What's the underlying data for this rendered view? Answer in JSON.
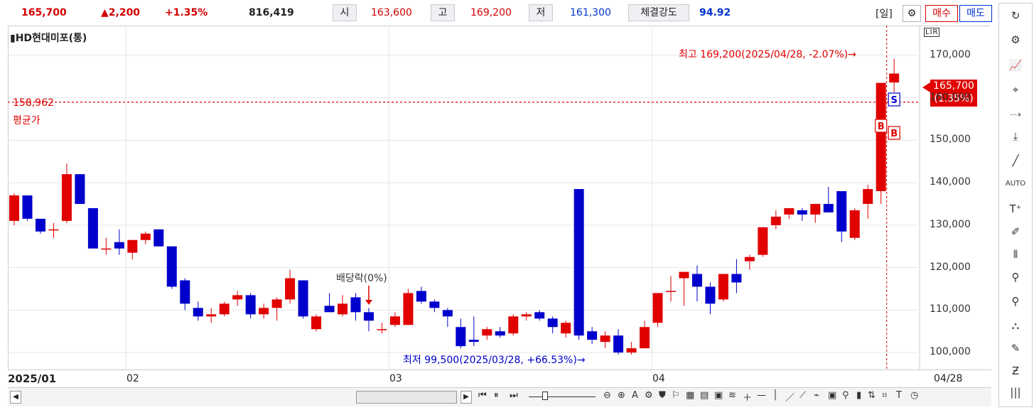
{
  "quote": {
    "price": "165,700",
    "change": "▲2,200",
    "change_pct": "+1.35%",
    "volume": "816,419",
    "open_label": "시",
    "open": "163,600",
    "high_label": "고",
    "high": "169,200",
    "low_label": "저",
    "low": "161,300",
    "strength_label": "체결강도",
    "strength": "94.92"
  },
  "toolbar": {
    "period": "[일]",
    "buy": "매수",
    "sell": "매도",
    "mode_badges": "LIR"
  },
  "chart": {
    "stock_name": "HD현대미포(통)",
    "avg_price_value": "158,962",
    "avg_price_label": "평균가",
    "high_note": "최고 169,200(2025/04/28, -2.07%)→",
    "low_note": "최저 99,500(2025/03/28, +66.53%)→",
    "dividend_note": "배당락(0%)",
    "current_tag_price": "165,700",
    "current_tag_pct": "(1.35%)",
    "signal_s": "S",
    "signal_b": "B",
    "yaxis_labels": [
      "170,000",
      "160,000",
      "150,000",
      "140,000",
      "130,000",
      "120,000",
      "110,000",
      "100,000"
    ],
    "date_labels": [
      "2025/01",
      "02",
      "03",
      "04",
      "04/28"
    ]
  },
  "colors": {
    "up": "#e00000",
    "down": "#0000cc",
    "grid": "#e6e6e6"
  },
  "chart_data": {
    "type": "candlestick",
    "ylim": [
      96000,
      177000
    ],
    "candles": [
      {
        "o": 131000,
        "h": 137500,
        "l": 130000,
        "c": 137000
      },
      {
        "o": 137000,
        "h": 137000,
        "l": 131000,
        "c": 131500
      },
      {
        "o": 131500,
        "h": 131500,
        "l": 128000,
        "c": 128500
      },
      {
        "o": 129000,
        "h": 130500,
        "l": 127000,
        "c": 129000
      },
      {
        "o": 131000,
        "h": 144500,
        "l": 130500,
        "c": 142000
      },
      {
        "o": 142000,
        "h": 142000,
        "l": 135000,
        "c": 135000
      },
      {
        "o": 134000,
        "h": 134000,
        "l": 124500,
        "c": 124500
      },
      {
        "o": 124500,
        "h": 127000,
        "l": 123000,
        "c": 124500
      },
      {
        "o": 126000,
        "h": 129000,
        "l": 123000,
        "c": 124500
      },
      {
        "o": 123500,
        "h": 126500,
        "l": 122000,
        "c": 126500
      },
      {
        "o": 126500,
        "h": 128500,
        "l": 125500,
        "c": 128000
      },
      {
        "o": 129000,
        "h": 129000,
        "l": 125000,
        "c": 125000
      },
      {
        "o": 125000,
        "h": 125000,
        "l": 115000,
        "c": 115500
      },
      {
        "o": 117000,
        "h": 117500,
        "l": 110000,
        "c": 111500
      },
      {
        "o": 110500,
        "h": 112000,
        "l": 107500,
        "c": 108500
      },
      {
        "o": 108500,
        "h": 110500,
        "l": 107000,
        "c": 109000
      },
      {
        "o": 109000,
        "h": 112000,
        "l": 108500,
        "c": 111500
      },
      {
        "o": 112500,
        "h": 114500,
        "l": 111000,
        "c": 113500
      },
      {
        "o": 113500,
        "h": 114000,
        "l": 108000,
        "c": 109000
      },
      {
        "o": 109000,
        "h": 111500,
        "l": 108000,
        "c": 110500
      },
      {
        "o": 110500,
        "h": 113000,
        "l": 107500,
        "c": 112500
      },
      {
        "o": 112500,
        "h": 119500,
        "l": 111500,
        "c": 117500
      },
      {
        "o": 117000,
        "h": 117000,
        "l": 108000,
        "c": 108500
      },
      {
        "o": 105500,
        "h": 109000,
        "l": 105000,
        "c": 108500
      },
      {
        "o": 111000,
        "h": 114000,
        "l": 110000,
        "c": 109500
      },
      {
        "o": 109000,
        "h": 113500,
        "l": 108500,
        "c": 111500
      },
      {
        "o": 113000,
        "h": 114000,
        "l": 107500,
        "c": 109500
      },
      {
        "o": 109500,
        "h": 110500,
        "l": 105000,
        "c": 107500
      },
      {
        "o": 105500,
        "h": 107000,
        "l": 104500,
        "c": 105500
      },
      {
        "o": 106500,
        "h": 109500,
        "l": 106000,
        "c": 108500
      },
      {
        "o": 106500,
        "h": 115000,
        "l": 106500,
        "c": 114000
      },
      {
        "o": 114500,
        "h": 115500,
        "l": 111500,
        "c": 112000
      },
      {
        "o": 112000,
        "h": 112500,
        "l": 109500,
        "c": 110500
      },
      {
        "o": 110000,
        "h": 110500,
        "l": 106000,
        "c": 108500
      },
      {
        "o": 106000,
        "h": 108000,
        "l": 101000,
        "c": 101500
      },
      {
        "o": 103000,
        "h": 108500,
        "l": 101500,
        "c": 102500
      },
      {
        "o": 104000,
        "h": 106000,
        "l": 103000,
        "c": 105500
      },
      {
        "o": 105000,
        "h": 106000,
        "l": 103500,
        "c": 104000
      },
      {
        "o": 104500,
        "h": 109000,
        "l": 104000,
        "c": 108500
      },
      {
        "o": 108500,
        "h": 109500,
        "l": 107500,
        "c": 109000
      },
      {
        "o": 109500,
        "h": 110000,
        "l": 107500,
        "c": 108000
      },
      {
        "o": 108000,
        "h": 108500,
        "l": 104500,
        "c": 106000
      },
      {
        "o": 104500,
        "h": 107500,
        "l": 103500,
        "c": 107000
      },
      {
        "o": 138500,
        "h": 138500,
        "l": 103000,
        "c": 104000
      },
      {
        "o": 105000,
        "h": 106000,
        "l": 102000,
        "c": 103000
      },
      {
        "o": 102500,
        "h": 105000,
        "l": 101000,
        "c": 104000
      },
      {
        "o": 104000,
        "h": 105500,
        "l": 99500,
        "c": 100000
      },
      {
        "o": 100000,
        "h": 102500,
        "l": 99500,
        "c": 101000
      },
      {
        "o": 101000,
        "h": 107500,
        "l": 101000,
        "c": 106000
      },
      {
        "o": 107000,
        "h": 114000,
        "l": 106000,
        "c": 114000
      },
      {
        "o": 114500,
        "h": 118000,
        "l": 112000,
        "c": 114500
      },
      {
        "o": 117500,
        "h": 119000,
        "l": 111000,
        "c": 119000
      },
      {
        "o": 118500,
        "h": 120500,
        "l": 112000,
        "c": 115500
      },
      {
        "o": 115500,
        "h": 116500,
        "l": 109000,
        "c": 111500
      },
      {
        "o": 112500,
        "h": 118500,
        "l": 112000,
        "c": 118500
      },
      {
        "o": 118500,
        "h": 122000,
        "l": 114000,
        "c": 116500
      },
      {
        "o": 121500,
        "h": 123000,
        "l": 119500,
        "c": 122500
      },
      {
        "o": 123000,
        "h": 129500,
        "l": 122500,
        "c": 129500
      },
      {
        "o": 130000,
        "h": 133500,
        "l": 129000,
        "c": 132000
      },
      {
        "o": 132500,
        "h": 134000,
        "l": 131500,
        "c": 134000
      },
      {
        "o": 133500,
        "h": 134000,
        "l": 131000,
        "c": 132500
      },
      {
        "o": 132500,
        "h": 135000,
        "l": 130500,
        "c": 135000
      },
      {
        "o": 135000,
        "h": 139000,
        "l": 133000,
        "c": 133000
      },
      {
        "o": 138000,
        "h": 138000,
        "l": 126000,
        "c": 128500
      },
      {
        "o": 127000,
        "h": 134000,
        "l": 126500,
        "c": 133500
      },
      {
        "o": 135000,
        "h": 139500,
        "l": 131500,
        "c": 138500
      },
      {
        "o": 138000,
        "h": 163500,
        "l": 135000,
        "c": 163500
      },
      {
        "o": 163600,
        "h": 169200,
        "l": 161300,
        "c": 165700
      }
    ]
  }
}
